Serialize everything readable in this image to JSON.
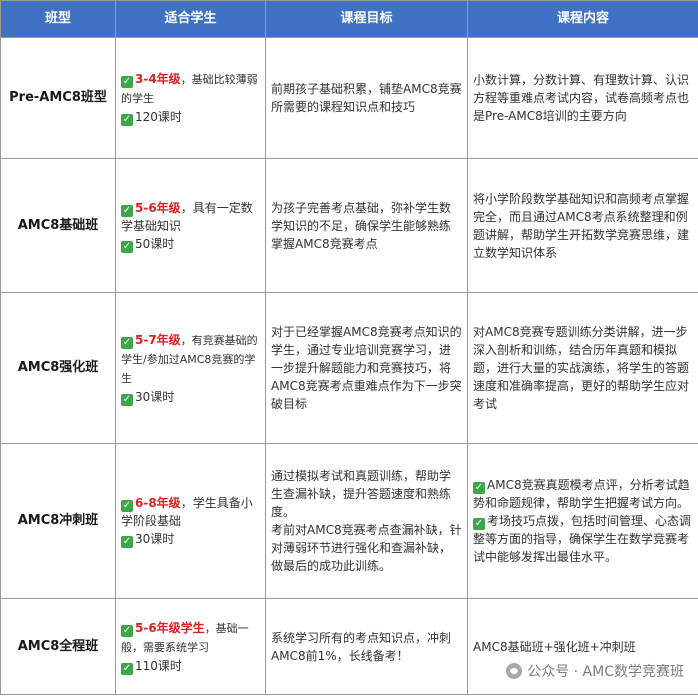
{
  "headers": [
    "班型",
    "适合学生",
    "课程目标",
    "课程内容"
  ],
  "rows": [
    {
      "type": "Pre-AMC8班型",
      "grade": "3-4年级",
      "suitable_rest": "，基础比较薄弱的学生",
      "hours": "120课时",
      "goal": "前期孩子基础积累，铺垫AMC8竞赛所需要的课程知识点和技巧",
      "content": "小数计算，分数计算、有理数计算、认识方程等重难点考试内容，试卷高频考点也是Pre-AMC8培训的主要方向"
    },
    {
      "type": "AMC8基础班",
      "grade": "5-6年级",
      "suitable_rest": "，具有一定数学基础知识",
      "hours": "50课时",
      "goal": "为孩子完善考点基础，弥补学生数学知识的不足，确保学生能够熟练掌握AMC8竞赛考点",
      "content": "将小学阶段数学基础知识和高频考点掌握完全，而且通过AMC8考点系统整理和例题讲解，帮助学生开拓数学竞赛思维，建立数学知识体系"
    },
    {
      "type": "AMC8强化班",
      "grade": "5-7年级",
      "suitable_rest": "，有竞赛基础的学生/参加过AMC8竞赛的学生",
      "hours": "30课时",
      "goal": "对于已经掌握AMC8竞赛考点知识的学生，通过专业培训竞赛学习，进一步提升解题能力和竞赛技巧，将AMC8竞赛考点重难点作为下一步突破目标",
      "content": "对AMC8竞赛专题训练分类讲解，进一步深入剖析和训练，结合历年真题和模拟题，进行大量的实战演练，将学生的答题速度和准确率提高，更好的帮助学生应对考试"
    },
    {
      "type": "AMC8冲刺班",
      "grade": "6-8年级",
      "suitable_rest": "，学生具备小学阶段基础",
      "hours": "30课时",
      "goal_p1": "通过模拟考试和真题训练，帮助学生查漏补缺，提升答题速度和熟练度。",
      "goal_p2": "考前对AMC8竞赛考点查漏补缺，针对薄弱环节进行强化和查漏补缺，做最后的成功此训练。",
      "content_p1": "AMC8竞赛真题模考点评，分析考试趋势和命题规律，帮助学生把握考试方向。",
      "content_p2": "考场技巧点拨，包括时间管理、心态调整等方面的指导，确保学生在数学竞赛考试中能够发挥出最佳水平。"
    },
    {
      "type": "AMC8全程班",
      "grade": "5-6年级学生",
      "suitable_rest": "，基础一般，需要系统学习",
      "hours": "110课时",
      "goal": "系统学习所有的考点知识点，冲刺AMC8前1%，长线备考！",
      "content": "AMC8基础班+强化班+冲刺班"
    }
  ],
  "watermark": "公众号 · AMC数学竞赛班",
  "colors": {
    "header_bg": "#3f72c3",
    "grade_red": "#e02020",
    "check_green": "#3ea64a"
  },
  "icons": {
    "check": "check-mark-icon",
    "watermark": "wechat-icon"
  }
}
